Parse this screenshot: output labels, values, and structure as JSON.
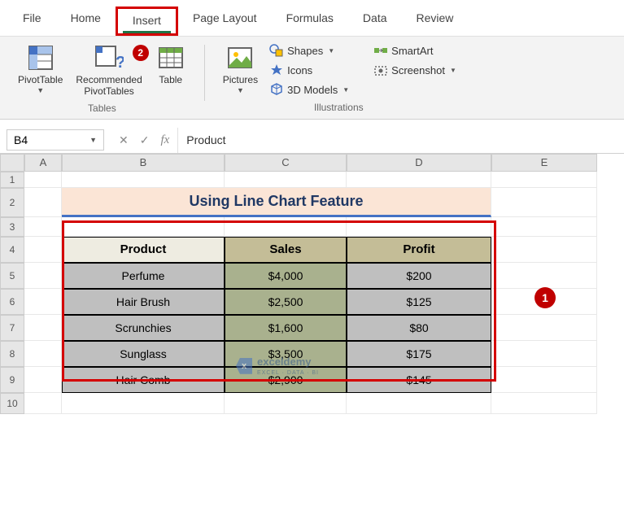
{
  "tabs": [
    "File",
    "Home",
    "Insert",
    "Page Layout",
    "Formulas",
    "Data",
    "Review"
  ],
  "activeTab": "Insert",
  "ribbon": {
    "tables": {
      "label": "Tables",
      "pivottable": "PivotTable",
      "recommended": "Recommended\nPivotTables",
      "table": "Table"
    },
    "illustrations": {
      "label": "Illustrations",
      "pictures": "Pictures",
      "shapes": "Shapes",
      "icons": "Icons",
      "models3d": "3D Models",
      "smartart": "SmartArt",
      "screenshot": "Screenshot"
    }
  },
  "nameBox": "B4",
  "formula": "Product",
  "sheetTitle": "Using Line Chart Feature",
  "columns": [
    "A",
    "B",
    "C",
    "D",
    "E"
  ],
  "rows": [
    "1",
    "2",
    "3",
    "4",
    "5",
    "6",
    "7",
    "8",
    "9",
    "10"
  ],
  "table": {
    "headers": [
      "Product",
      "Sales",
      "Profit"
    ],
    "data": [
      {
        "product": "Perfume",
        "sales": "$4,000",
        "profit": "$200"
      },
      {
        "product": "Hair Brush",
        "sales": "$2,500",
        "profit": "$125"
      },
      {
        "product": "Scrunchies",
        "sales": "$1,600",
        "profit": "$80"
      },
      {
        "product": "Sunglass",
        "sales": "$3,500",
        "profit": "$175"
      },
      {
        "product": "Hair Comb",
        "sales": "$2,900",
        "profit": "$145"
      }
    ]
  },
  "badges": {
    "step1": "1",
    "step2": "2"
  },
  "watermark": {
    "brand": "exceldemy",
    "tagline": "EXCEL · DATA · BI"
  }
}
